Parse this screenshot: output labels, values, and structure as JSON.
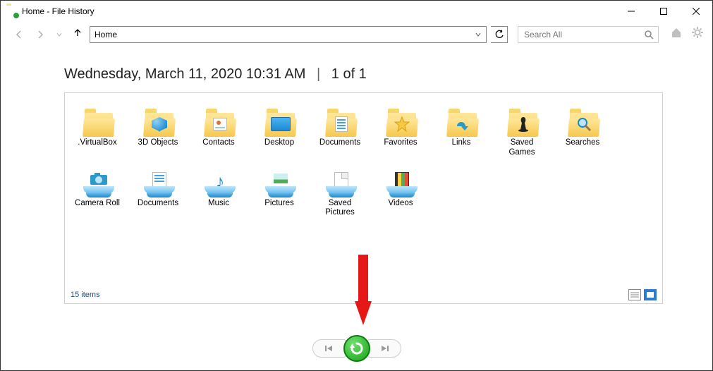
{
  "titlebar": {
    "title": "Home - File History"
  },
  "nav": {
    "address": "Home",
    "search_placeholder": "Search All"
  },
  "heading": {
    "date": "Wednesday, March 11, 2020 10:31 AM",
    "position": "1 of 1"
  },
  "items": [
    {
      "id": "vbox",
      "label": ".VirtualBox",
      "icon": "folder"
    },
    {
      "id": "3d",
      "label": "3D Objects",
      "icon": "folder-3d"
    },
    {
      "id": "contacts",
      "label": "Contacts",
      "icon": "folder-contacts"
    },
    {
      "id": "desktop",
      "label": "Desktop",
      "icon": "folder-desktop"
    },
    {
      "id": "docs",
      "label": "Documents",
      "icon": "folder-docs"
    },
    {
      "id": "fav",
      "label": "Favorites",
      "icon": "folder-star"
    },
    {
      "id": "links",
      "label": "Links",
      "icon": "folder-link"
    },
    {
      "id": "saved",
      "label": "Saved Games",
      "icon": "folder-chess"
    },
    {
      "id": "search",
      "label": "Searches",
      "icon": "folder-mag"
    },
    {
      "id": "camera",
      "label": "Camera Roll",
      "icon": "lib-camera"
    },
    {
      "id": "libdocs",
      "label": "Documents",
      "icon": "lib-doc"
    },
    {
      "id": "music",
      "label": "Music",
      "icon": "lib-music"
    },
    {
      "id": "pics",
      "label": "Pictures",
      "icon": "lib-pic"
    },
    {
      "id": "savedpic",
      "label": "Saved Pictures",
      "icon": "lib-savepic"
    },
    {
      "id": "videos",
      "label": "Videos",
      "icon": "lib-video"
    }
  ],
  "status": {
    "count_text": "15 items"
  }
}
